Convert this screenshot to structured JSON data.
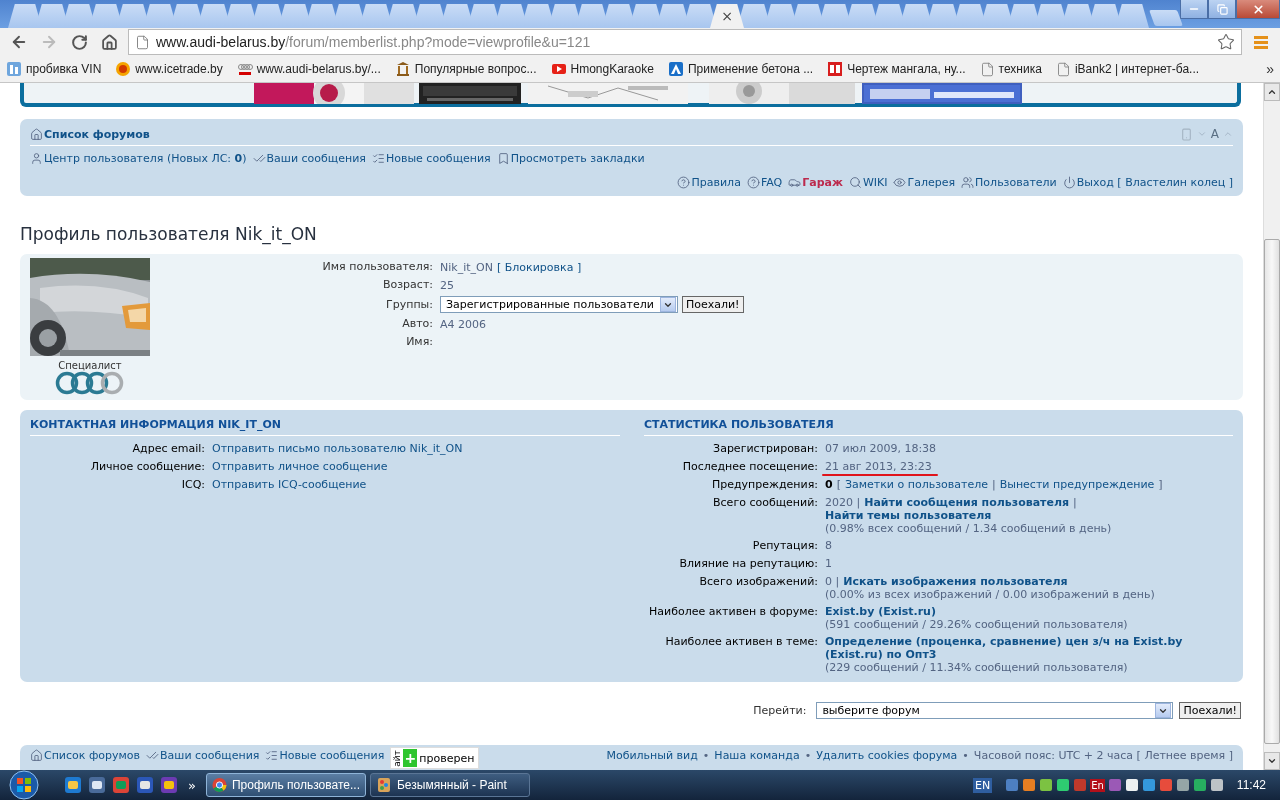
{
  "browser": {
    "tabs": [
      {
        "selected": false
      },
      {
        "selected": false
      },
      {
        "selected": false
      },
      {
        "selected": false
      },
      {
        "selected": false
      },
      {
        "selected": false
      },
      {
        "selected": false
      },
      {
        "selected": false
      },
      {
        "selected": false
      },
      {
        "selected": false
      },
      {
        "selected": false
      },
      {
        "selected": false
      },
      {
        "selected": false
      },
      {
        "selected": false
      },
      {
        "selected": false
      },
      {
        "selected": false
      },
      {
        "selected": false
      },
      {
        "selected": false
      },
      {
        "selected": false
      },
      {
        "selected": false
      },
      {
        "selected": false
      },
      {
        "selected": false
      },
      {
        "selected": false
      },
      {
        "selected": false
      },
      {
        "selected": false
      },
      {
        "selected": false
      },
      {
        "selected": true
      },
      {
        "selected": false
      },
      {
        "selected": false
      },
      {
        "selected": false
      },
      {
        "selected": false
      },
      {
        "selected": false
      },
      {
        "selected": false
      },
      {
        "selected": false
      },
      {
        "selected": false
      },
      {
        "selected": false
      },
      {
        "selected": false
      },
      {
        "selected": false
      },
      {
        "selected": false
      },
      {
        "selected": false
      },
      {
        "selected": false
      },
      {
        "selected": false
      }
    ],
    "tab_close": "×",
    "address": {
      "host": "www.audi-belarus.by",
      "path": "/forum/memberlist.php?mode=viewprofile&u=121"
    },
    "bookmarks": [
      {
        "label": "пробивка VIN"
      },
      {
        "label": "www.icetrade.by"
      },
      {
        "label": "www.audi-belarus.by/..."
      },
      {
        "label": "Популярные вопрос..."
      },
      {
        "label": "HmongKaraoke"
      },
      {
        "label": "Применение бетона ..."
      },
      {
        "label": "Чертеж мангала, ну..."
      },
      {
        "label": "техника"
      },
      {
        "label": "iBank2 | интернет-ба..."
      }
    ],
    "bookmarks_more": "»"
  },
  "nav": {
    "home": "Список форумов",
    "font_control": "A",
    "user_links": [
      {
        "label": "Центр пользователя (Новых ЛС: **0**)"
      },
      {
        "label": "Ваши сообщения"
      },
      {
        "label": "Новые сообщения"
      },
      {
        "label": "Просмотреть закладки"
      }
    ],
    "site_links": [
      {
        "label": "Правила",
        "highlight": false
      },
      {
        "label": "FAQ",
        "highlight": false
      },
      {
        "label": "Гараж",
        "highlight": true
      },
      {
        "label": "WIKI",
        "highlight": false
      },
      {
        "label": "Галерея",
        "highlight": false
      },
      {
        "label": "Пользователи",
        "highlight": false
      },
      {
        "label": "Выход [ Властелин колец ]",
        "highlight": false
      }
    ]
  },
  "profile": {
    "title": "Профиль пользователя Nik_it_ON",
    "rank": "Специалист",
    "fields": [
      {
        "kind": "text",
        "label": "Имя пользователя:",
        "value": "Nik_it_ON",
        "link": "[ Блокировка ]"
      },
      {
        "kind": "text",
        "label": "Возраст:",
        "value": "25"
      },
      {
        "kind": "select",
        "label": "Группы:",
        "value": "Зарегистрированные пользователи",
        "button": "Поехали!"
      },
      {
        "kind": "text",
        "label": "Авто:",
        "value": "A4 2006"
      },
      {
        "kind": "text",
        "label": "Имя:"
      }
    ]
  },
  "contact": {
    "title": "КОНТАКТНАЯ ИНФОРМАЦИЯ NIK_IT_ON",
    "rows": [
      {
        "label": "Адрес email:",
        "link": "Отправить письмо пользователю Nik_it_ON"
      },
      {
        "label": "Личное сообщение:",
        "link": "Отправить личное сообщение"
      },
      {
        "label": "ICQ:",
        "link": "Отправить ICQ-сообщение"
      }
    ]
  },
  "stats": {
    "title": "СТАТИСТИКА ПОЛЬЗОВАТЕЛЯ",
    "rows": [
      {
        "label": "Зарегистрирован:",
        "underlined": false,
        "parts": [
          {
            "kind": "plain",
            "text": "07 июл 2009, 18:38"
          }
        ]
      },
      {
        "label": "Последнее посещение:",
        "underlined": true,
        "parts": [
          {
            "kind": "plain",
            "text": "21 авг 2013, 23:23"
          }
        ]
      },
      {
        "label": "Предупреждения:",
        "underlined": false,
        "parts": [
          {
            "kind": "bold",
            "text": "0"
          },
          {
            "kind": "plain",
            "text": "["
          },
          {
            "kind": "link",
            "text": "Заметки о пользователе"
          },
          {
            "kind": "plain",
            "text": "|"
          },
          {
            "kind": "link",
            "text": "Вынести предупреждение"
          },
          {
            "kind": "plain",
            "text": "]"
          }
        ]
      },
      {
        "label": "Всего сообщений:",
        "underlined": false,
        "parts": [
          {
            "kind": "plain",
            "text": "2020 |"
          },
          {
            "kind": "strong-link",
            "text": "Найти сообщения пользователя"
          },
          {
            "kind": "plain",
            "text": "|"
          },
          {
            "kind": "strong-link",
            "text": "Найти темы пользователя"
          }
        ],
        "note": "(0.98% всех сообщений / 1.34 сообщений в день)"
      },
      {
        "label": "Репутация:",
        "underlined": false,
        "parts": [
          {
            "kind": "plain",
            "text": "8"
          }
        ]
      },
      {
        "label": "Влияние на репутацию:",
        "underlined": false,
        "parts": [
          {
            "kind": "plain",
            "text": "1"
          }
        ]
      },
      {
        "label": "Всего изображений:",
        "underlined": false,
        "parts": [
          {
            "kind": "plain",
            "text": "0 |"
          },
          {
            "kind": "strong-link",
            "text": "Искать изображения пользователя"
          }
        ],
        "note": "(0.00% из всех изображений / 0.00 изображений в день)"
      },
      {
        "label": "Наиболее активен в форуме:",
        "underlined": false,
        "parts": [
          {
            "kind": "strong-link",
            "text": "Exist.by (Exist.ru)"
          }
        ],
        "note": "(591 сообщений / 29.26% сообщений пользователя)"
      },
      {
        "label": "Наиболее активен в теме:",
        "underlined": false,
        "parts": [
          {
            "kind": "strong-link",
            "text": "Определение (проценка, сравнение) цен з/ч на Exist.by (Exist.ru) по Опт3"
          }
        ],
        "note": "(229 сообщений / 11.34% сообщений пользователя)"
      }
    ]
  },
  "jump": {
    "label": "Перейти:",
    "value": "выберите форум",
    "button": "Поехали!"
  },
  "footer": {
    "links": [
      {
        "label": "Список форумов"
      },
      {
        "label": "Ваши сообщения"
      },
      {
        "label": "Новые сообщения"
      }
    ],
    "badge": {
      "side": "айт",
      "plus": "+",
      "label": "проверен"
    },
    "right": [
      {
        "kind": "link",
        "text": "Мобильный вид"
      },
      {
        "kind": "sep",
        "text": "•"
      },
      {
        "kind": "link",
        "text": "Наша команда"
      },
      {
        "kind": "sep",
        "text": "•"
      },
      {
        "kind": "link",
        "text": "Удалить cookies форума"
      },
      {
        "kind": "sep",
        "text": "•"
      },
      {
        "kind": "plain",
        "text": "Часовой пояс: UTC + 2 часа [ Летнее время ]"
      }
    ]
  },
  "taskbar": {
    "quick_more": "»",
    "tasks": [
      {
        "label": "Профиль пользовате...",
        "selected": true
      },
      {
        "label": "Безымянный - Paint",
        "selected": false
      }
    ],
    "language": "EN",
    "tray_badge": "En",
    "clock": "11:42"
  }
}
